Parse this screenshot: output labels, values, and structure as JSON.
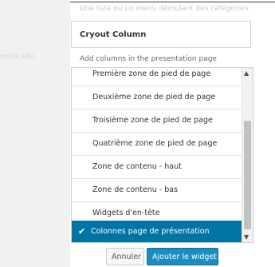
{
  "top_mark": "é",
  "top_description": "Une liste ou un menu déroulant des catégories.",
  "sidebar_description": "votre site.",
  "widget": {
    "title": "Cryout Column",
    "description": "Add columns in the presentation page"
  },
  "sidebar_list": {
    "items": [
      {
        "label": "Première zone de pied de page"
      },
      {
        "label": "Deuxième zone de pied de page"
      },
      {
        "label": "Troisième zone de pied de page"
      },
      {
        "label": "Quatrième zone de pied de page"
      },
      {
        "label": "Zone de contenu - haut"
      },
      {
        "label": "Zone de contenu - bas"
      },
      {
        "label": "Widgets d'en-tête"
      },
      {
        "label": "Colonnes page de présentation",
        "selected": true
      }
    ]
  },
  "icons": {
    "check": "check-icon",
    "scroll_up": "chevron-up-icon",
    "scroll_down": "chevron-down-icon"
  },
  "colors": {
    "selected_bg": "#0074a2",
    "primary_button": "#1e8cbe"
  },
  "buttons": {
    "cancel_label": "Annuler",
    "add_label": "Ajouter le widget"
  }
}
